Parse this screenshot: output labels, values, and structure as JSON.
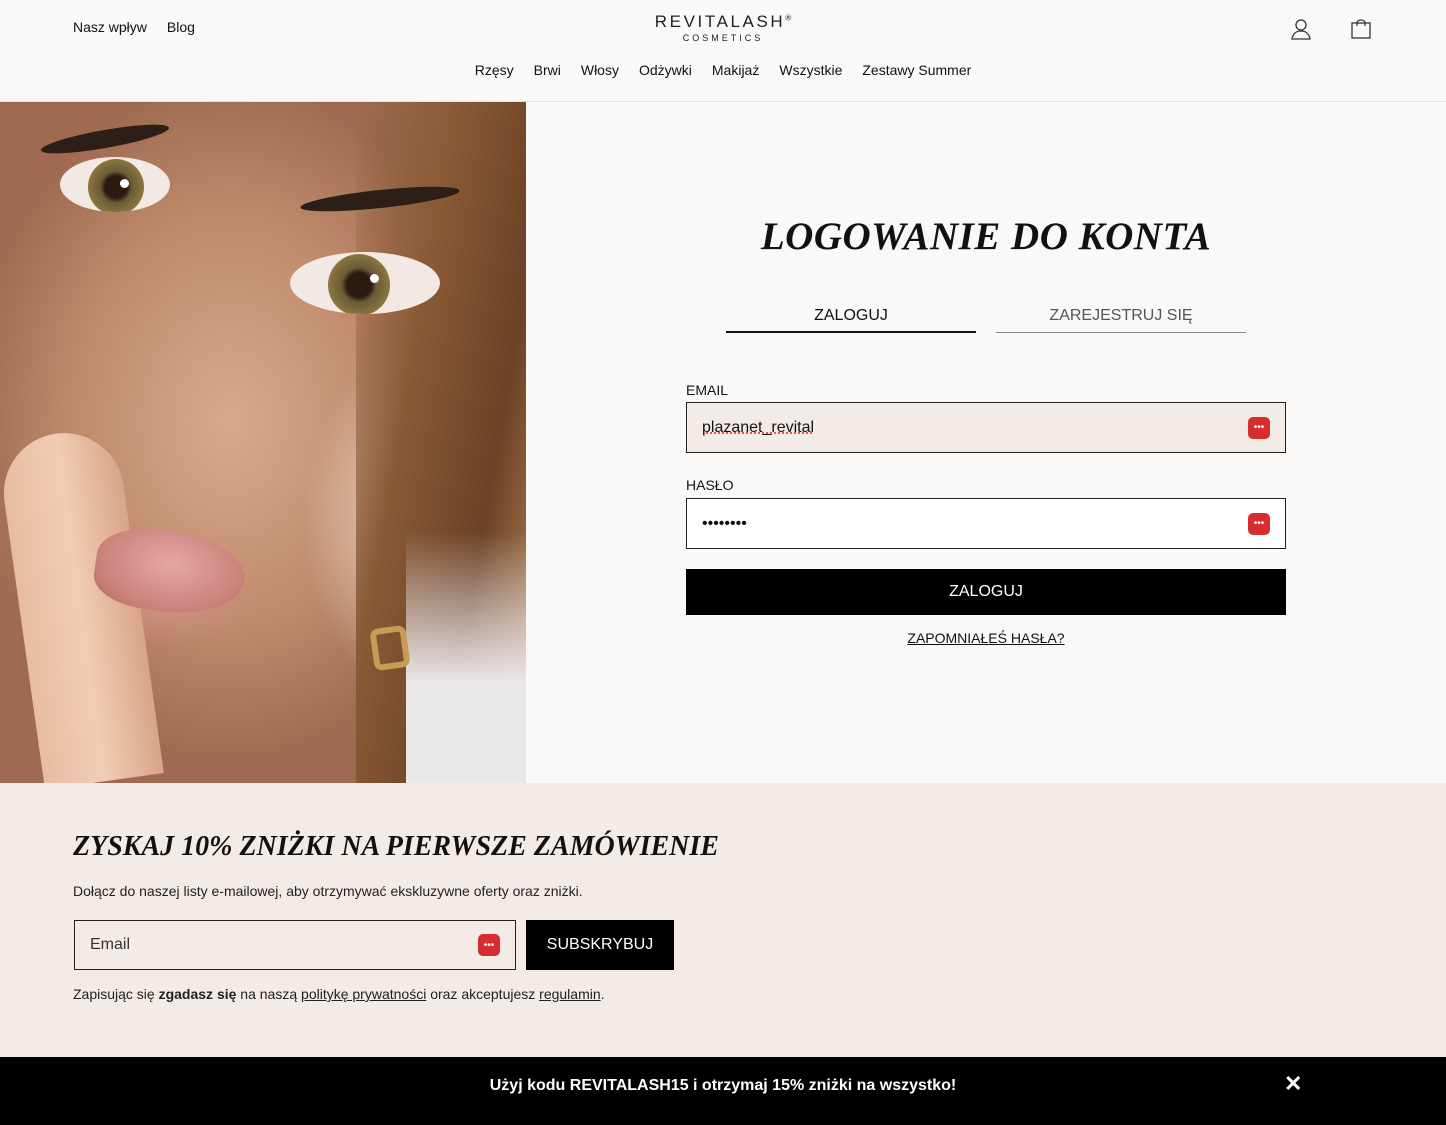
{
  "header": {
    "top_links": [
      "Nasz wpływ",
      "Blog"
    ],
    "logo_main": "REVITALASH",
    "logo_reg": "®",
    "logo_sub": "COSMETICS",
    "icons": [
      "account-icon",
      "shopping-bag-icon"
    ],
    "nav": [
      "Rzęsy",
      "Brwi",
      "Włosy",
      "Odżywki",
      "Makijaż",
      "Wszystkie",
      "Zestawy Summer"
    ]
  },
  "login": {
    "title": "LOGOWANIE DO KONTA",
    "tabs": [
      "ZALOGUJ",
      "ZAREJESTRUJ SIĘ"
    ],
    "active_tab": "ZALOGUJ",
    "email_label": "EMAIL",
    "email_value": "plazanet_revital",
    "password_label": "HASŁO",
    "password_value": "••••••••",
    "submit_label": "ZALOGUJ",
    "forgot_label": "ZAPOMNIAŁEŚ HASŁA?"
  },
  "newsletter": {
    "title": "ZYSKAJ 10% ZNIŻKI NA PIERWSZE ZAMÓWIENIE",
    "description": "Dołącz do naszej listy e-mailowej, aby otrzymywać ekskluzywne oferty oraz zniżki.",
    "email_placeholder": "Email",
    "submit_label": "SUBSKRYBUJ",
    "consent_1": "Zapisując się ",
    "consent_bold": "zgadasz się",
    "consent_2": " na naszą ",
    "privacy_link": "politykę prywatności",
    "consent_3": " oraz akceptujesz ",
    "terms_link": "regulamin",
    "consent_4": "."
  },
  "promo": {
    "text": "Użyj kodu REVITALASH15 i otrzymaj 15% zniżki na wszystko!",
    "close": "✕"
  },
  "colors": {
    "page_bg": "#faf9f7",
    "newsletter_bg": "#f3ebe6",
    "button_bg": "#000000",
    "password_manager_icon": "#d62e2e"
  }
}
